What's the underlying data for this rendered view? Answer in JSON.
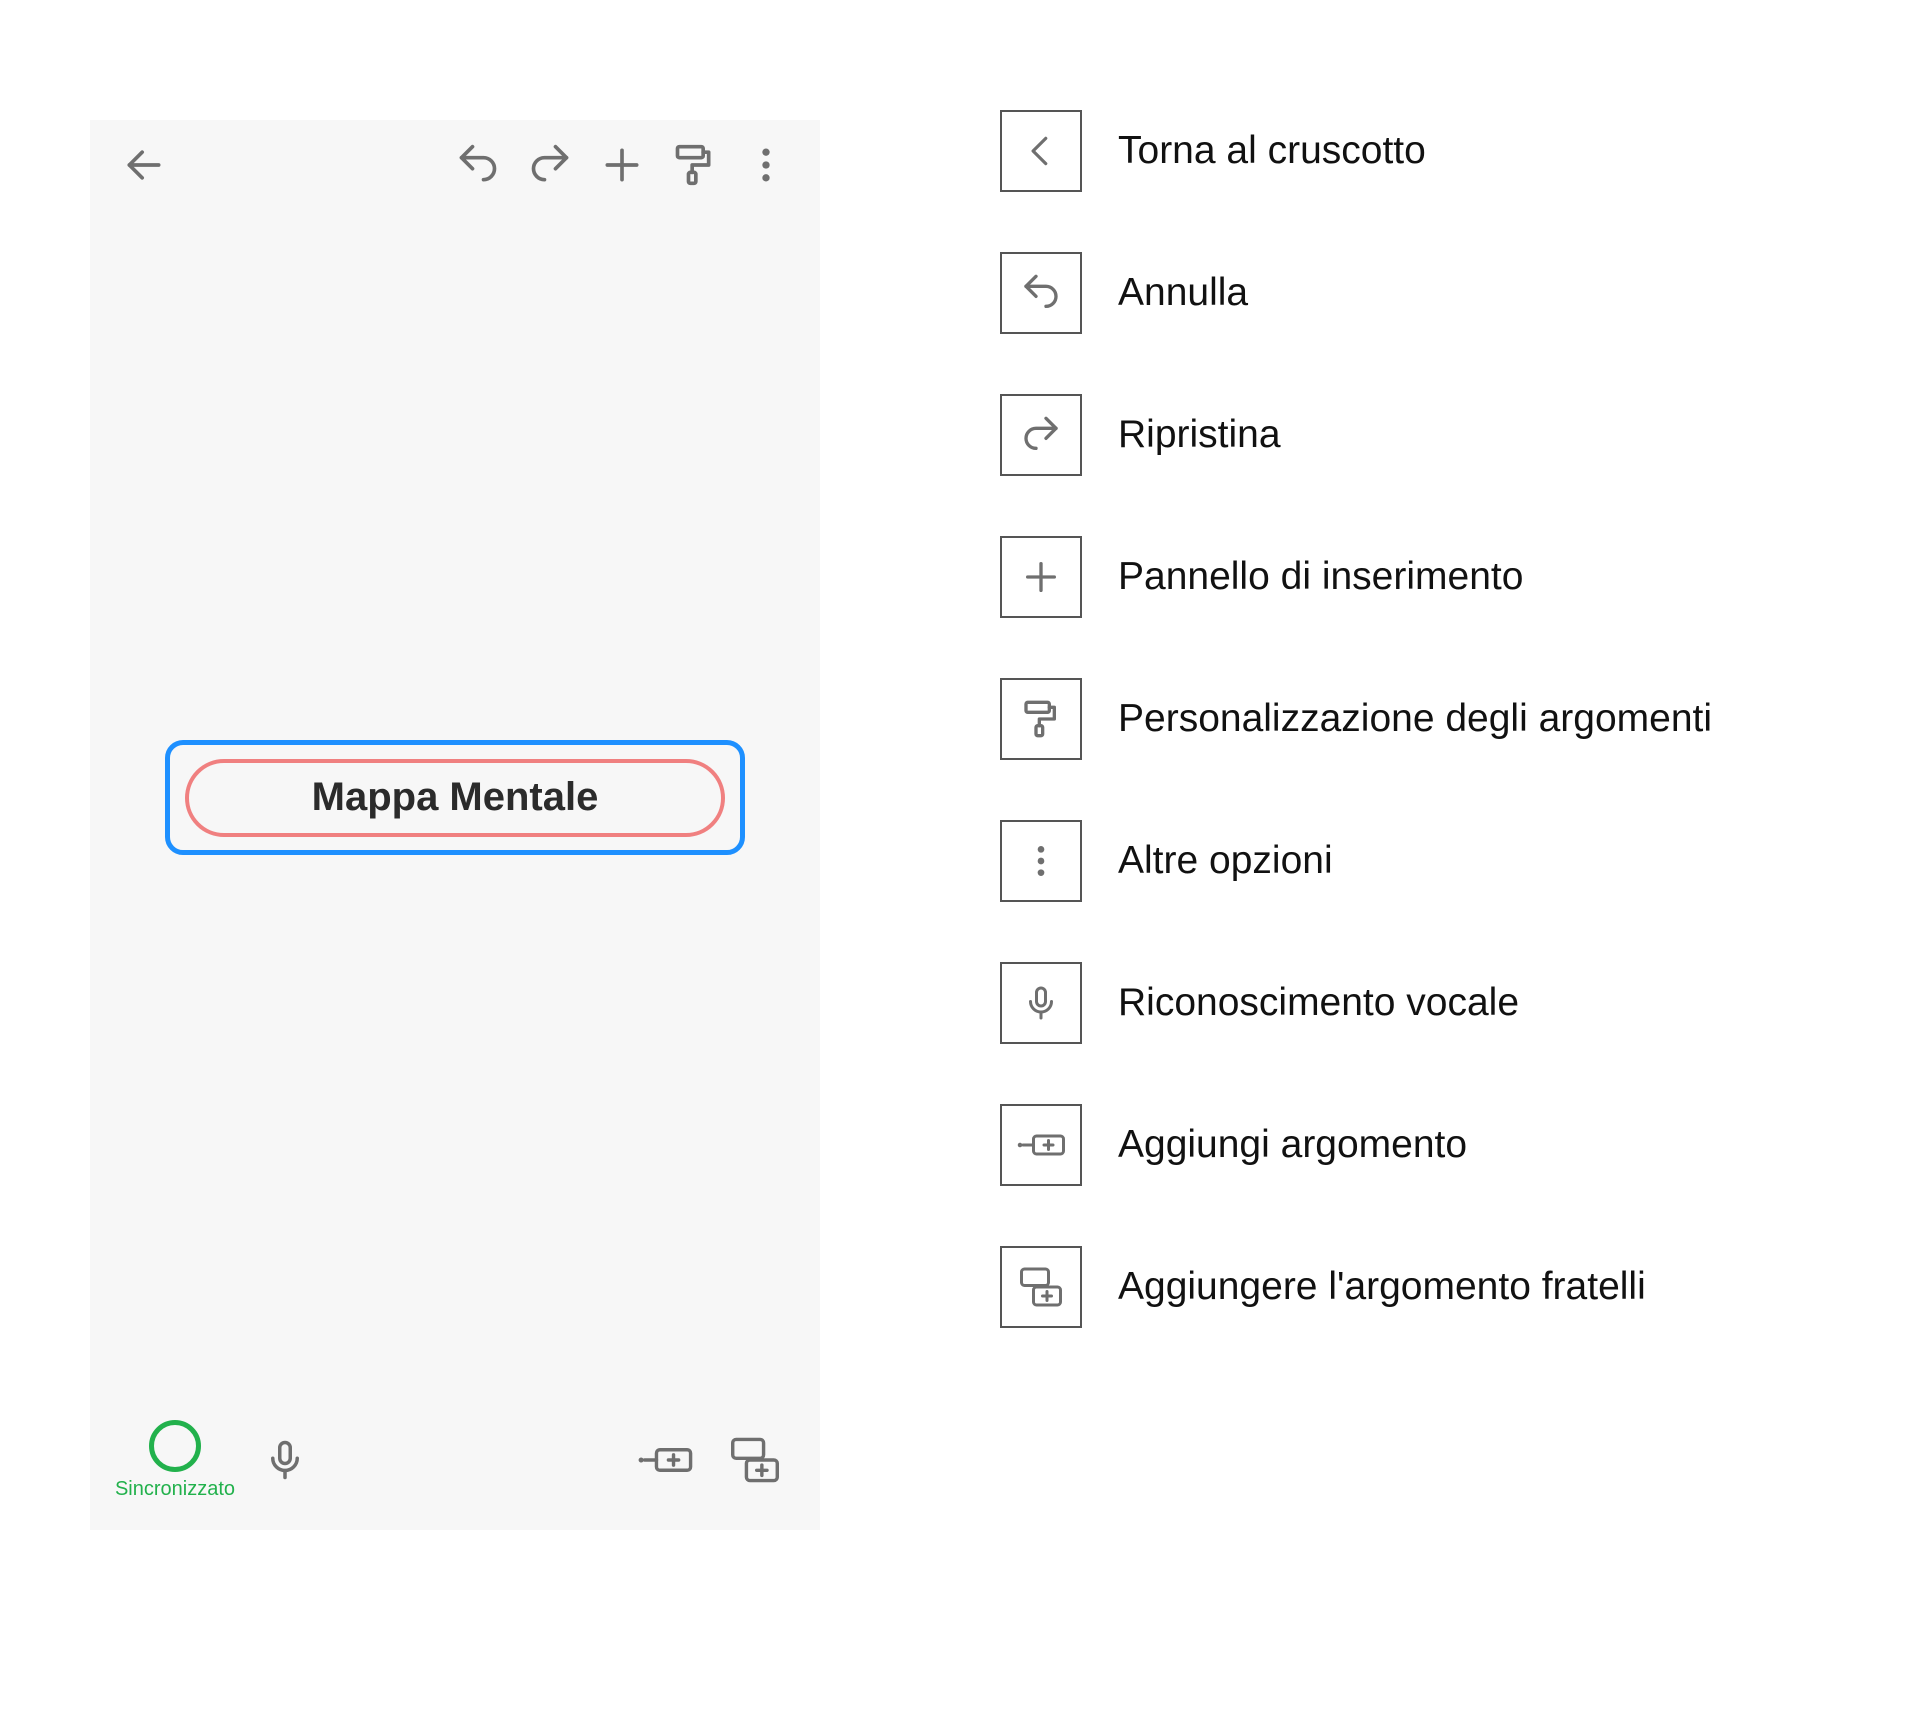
{
  "app": {
    "node_title": "Mappa Mentale",
    "sync_label": "Sincronizzato",
    "topbar_icons": {
      "back": "back-arrow-icon",
      "undo": "undo-icon",
      "redo": "redo-icon",
      "add": "plus-icon",
      "style": "paint-roller-icon",
      "more": "more-vertical-icon"
    },
    "bottombar_icons": {
      "sync": "sync-circle-icon",
      "voice": "microphone-icon",
      "add_topic": "add-topic-icon",
      "add_sibling": "add-sibling-icon"
    }
  },
  "legend": {
    "items": [
      {
        "icon": "chevron-left-icon",
        "label": "Torna al cruscotto"
      },
      {
        "icon": "undo-icon",
        "label": "Annulla"
      },
      {
        "icon": "redo-icon",
        "label": "Ripristina"
      },
      {
        "icon": "plus-icon",
        "label": "Pannello di inserimento"
      },
      {
        "icon": "paint-roller-icon",
        "label": "Personalizzazione degli argomenti"
      },
      {
        "icon": "more-vertical-icon",
        "label": "Altre opzioni"
      },
      {
        "icon": "microphone-icon",
        "label": "Riconoscimento vocale"
      },
      {
        "icon": "add-topic-icon",
        "label": "Aggiungi argomento"
      },
      {
        "icon": "add-sibling-icon",
        "label": "Aggiungere l'argomento fratelli"
      }
    ]
  },
  "colors": {
    "selection_outer": "#1E90FF",
    "selection_inner": "#F08080",
    "sync_green": "#22b14c",
    "icon_gray": "#6f6f6f"
  }
}
